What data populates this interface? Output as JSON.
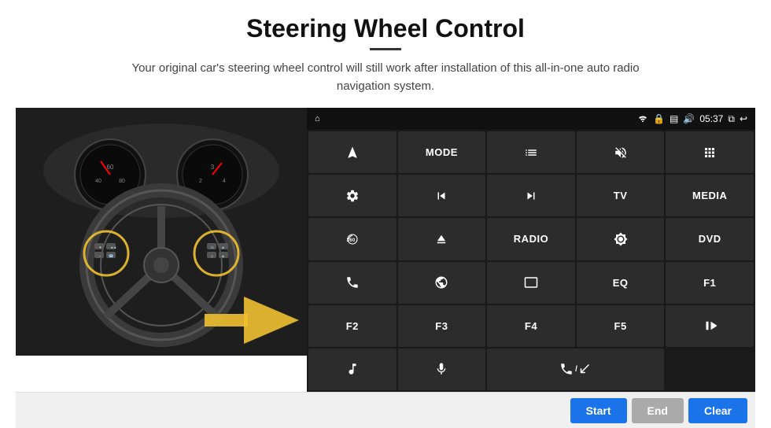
{
  "page": {
    "title": "Steering Wheel Control",
    "subtitle": "Your original car's steering wheel control will still work after installation of this all-in-one auto radio navigation system."
  },
  "statusbar": {
    "time": "05:37",
    "home_icon": "⌂",
    "wifi_icon": "wifi",
    "lock_icon": "🔒",
    "sd_icon": "💾",
    "bt_icon": "🔊",
    "window_icon": "⧉",
    "back_icon": "↩"
  },
  "buttons": [
    {
      "id": "b1",
      "label": "nav",
      "type": "icon"
    },
    {
      "id": "b2",
      "label": "MODE",
      "type": "text"
    },
    {
      "id": "b3",
      "label": "list",
      "type": "icon"
    },
    {
      "id": "b4",
      "label": "mute",
      "type": "icon"
    },
    {
      "id": "b5",
      "label": "apps",
      "type": "icon"
    },
    {
      "id": "b6",
      "label": "settings",
      "type": "icon"
    },
    {
      "id": "b7",
      "label": "prev",
      "type": "icon"
    },
    {
      "id": "b8",
      "label": "next",
      "type": "icon"
    },
    {
      "id": "b9",
      "label": "TV",
      "type": "text"
    },
    {
      "id": "b10",
      "label": "MEDIA",
      "type": "text"
    },
    {
      "id": "b11",
      "label": "360cam",
      "type": "icon"
    },
    {
      "id": "b12",
      "label": "eject",
      "type": "icon"
    },
    {
      "id": "b13",
      "label": "RADIO",
      "type": "text"
    },
    {
      "id": "b14",
      "label": "brightness",
      "type": "icon"
    },
    {
      "id": "b15",
      "label": "DVD",
      "type": "text"
    },
    {
      "id": "b16",
      "label": "phone",
      "type": "icon"
    },
    {
      "id": "b17",
      "label": "web",
      "type": "icon"
    },
    {
      "id": "b18",
      "label": "screen",
      "type": "icon"
    },
    {
      "id": "b19",
      "label": "EQ",
      "type": "text"
    },
    {
      "id": "b20",
      "label": "F1",
      "type": "text"
    },
    {
      "id": "b21",
      "label": "F2",
      "type": "text"
    },
    {
      "id": "b22",
      "label": "F3",
      "type": "text"
    },
    {
      "id": "b23",
      "label": "F4",
      "type": "text"
    },
    {
      "id": "b24",
      "label": "F5",
      "type": "text"
    },
    {
      "id": "b25",
      "label": "playpause",
      "type": "icon"
    },
    {
      "id": "b26",
      "label": "music",
      "type": "icon"
    },
    {
      "id": "b27",
      "label": "mic",
      "type": "icon"
    },
    {
      "id": "b28",
      "label": "hangup",
      "type": "icon"
    },
    {
      "id": "b29",
      "label": "",
      "type": "empty"
    },
    {
      "id": "b30",
      "label": "",
      "type": "empty"
    }
  ],
  "bottom_bar": {
    "start_label": "Start",
    "end_label": "End",
    "clear_label": "Clear"
  }
}
